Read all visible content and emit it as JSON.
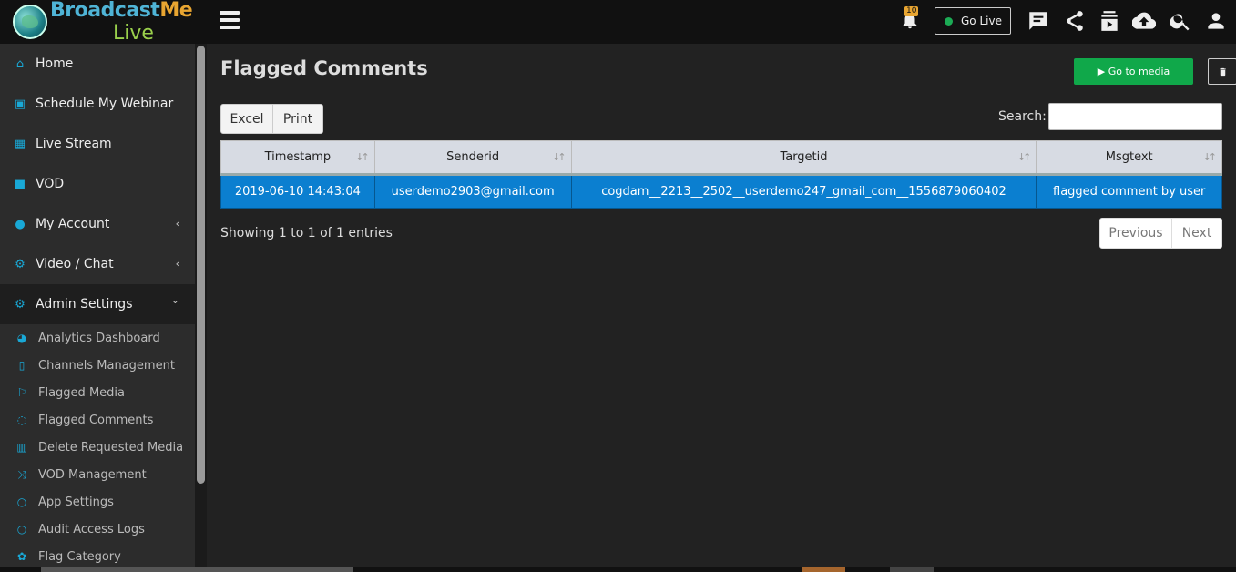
{
  "brand": {
    "name_main": "Broadcast",
    "name_me": "Me",
    "name_live": "Live"
  },
  "topbar": {
    "notification_count": "10",
    "go_live_label": "Go Live"
  },
  "sidebar": {
    "items": [
      {
        "label": "Home"
      },
      {
        "label": "Schedule My Webinar"
      },
      {
        "label": "Live Stream"
      },
      {
        "label": "VOD"
      },
      {
        "label": "My Account",
        "chevron": "‹"
      },
      {
        "label": "Video / Chat",
        "chevron": "‹"
      },
      {
        "label": "Admin Settings",
        "chevron": "⌄"
      }
    ],
    "subitems": [
      {
        "label": "Analytics Dashboard"
      },
      {
        "label": "Channels Management"
      },
      {
        "label": "Flagged Media"
      },
      {
        "label": "Flagged Comments"
      },
      {
        "label": "Delete Requested Media"
      },
      {
        "label": "VOD Management"
      },
      {
        "label": "App Settings"
      },
      {
        "label": "Audit Access Logs"
      },
      {
        "label": "Flag Category"
      }
    ]
  },
  "main": {
    "title": "Flagged Comments",
    "go_to_media_label": "▶ Go to media",
    "export_buttons": [
      "Excel",
      "Print"
    ],
    "search_label": "Search:",
    "search_value": "",
    "table": {
      "headers": [
        "Timestamp",
        "Senderid",
        "Targetid",
        "Msgtext"
      ],
      "rows": [
        [
          "2019-06-10 14:43:04",
          "userdemo2903@gmail.com",
          "cogdam__2213__2502__userdemo247_gmail_com__1556879060402",
          "flagged comment by user"
        ]
      ]
    },
    "info": "Showing 1 to 1 of 1 entries",
    "pager": {
      "previous": "Previous",
      "next": "Next"
    }
  }
}
